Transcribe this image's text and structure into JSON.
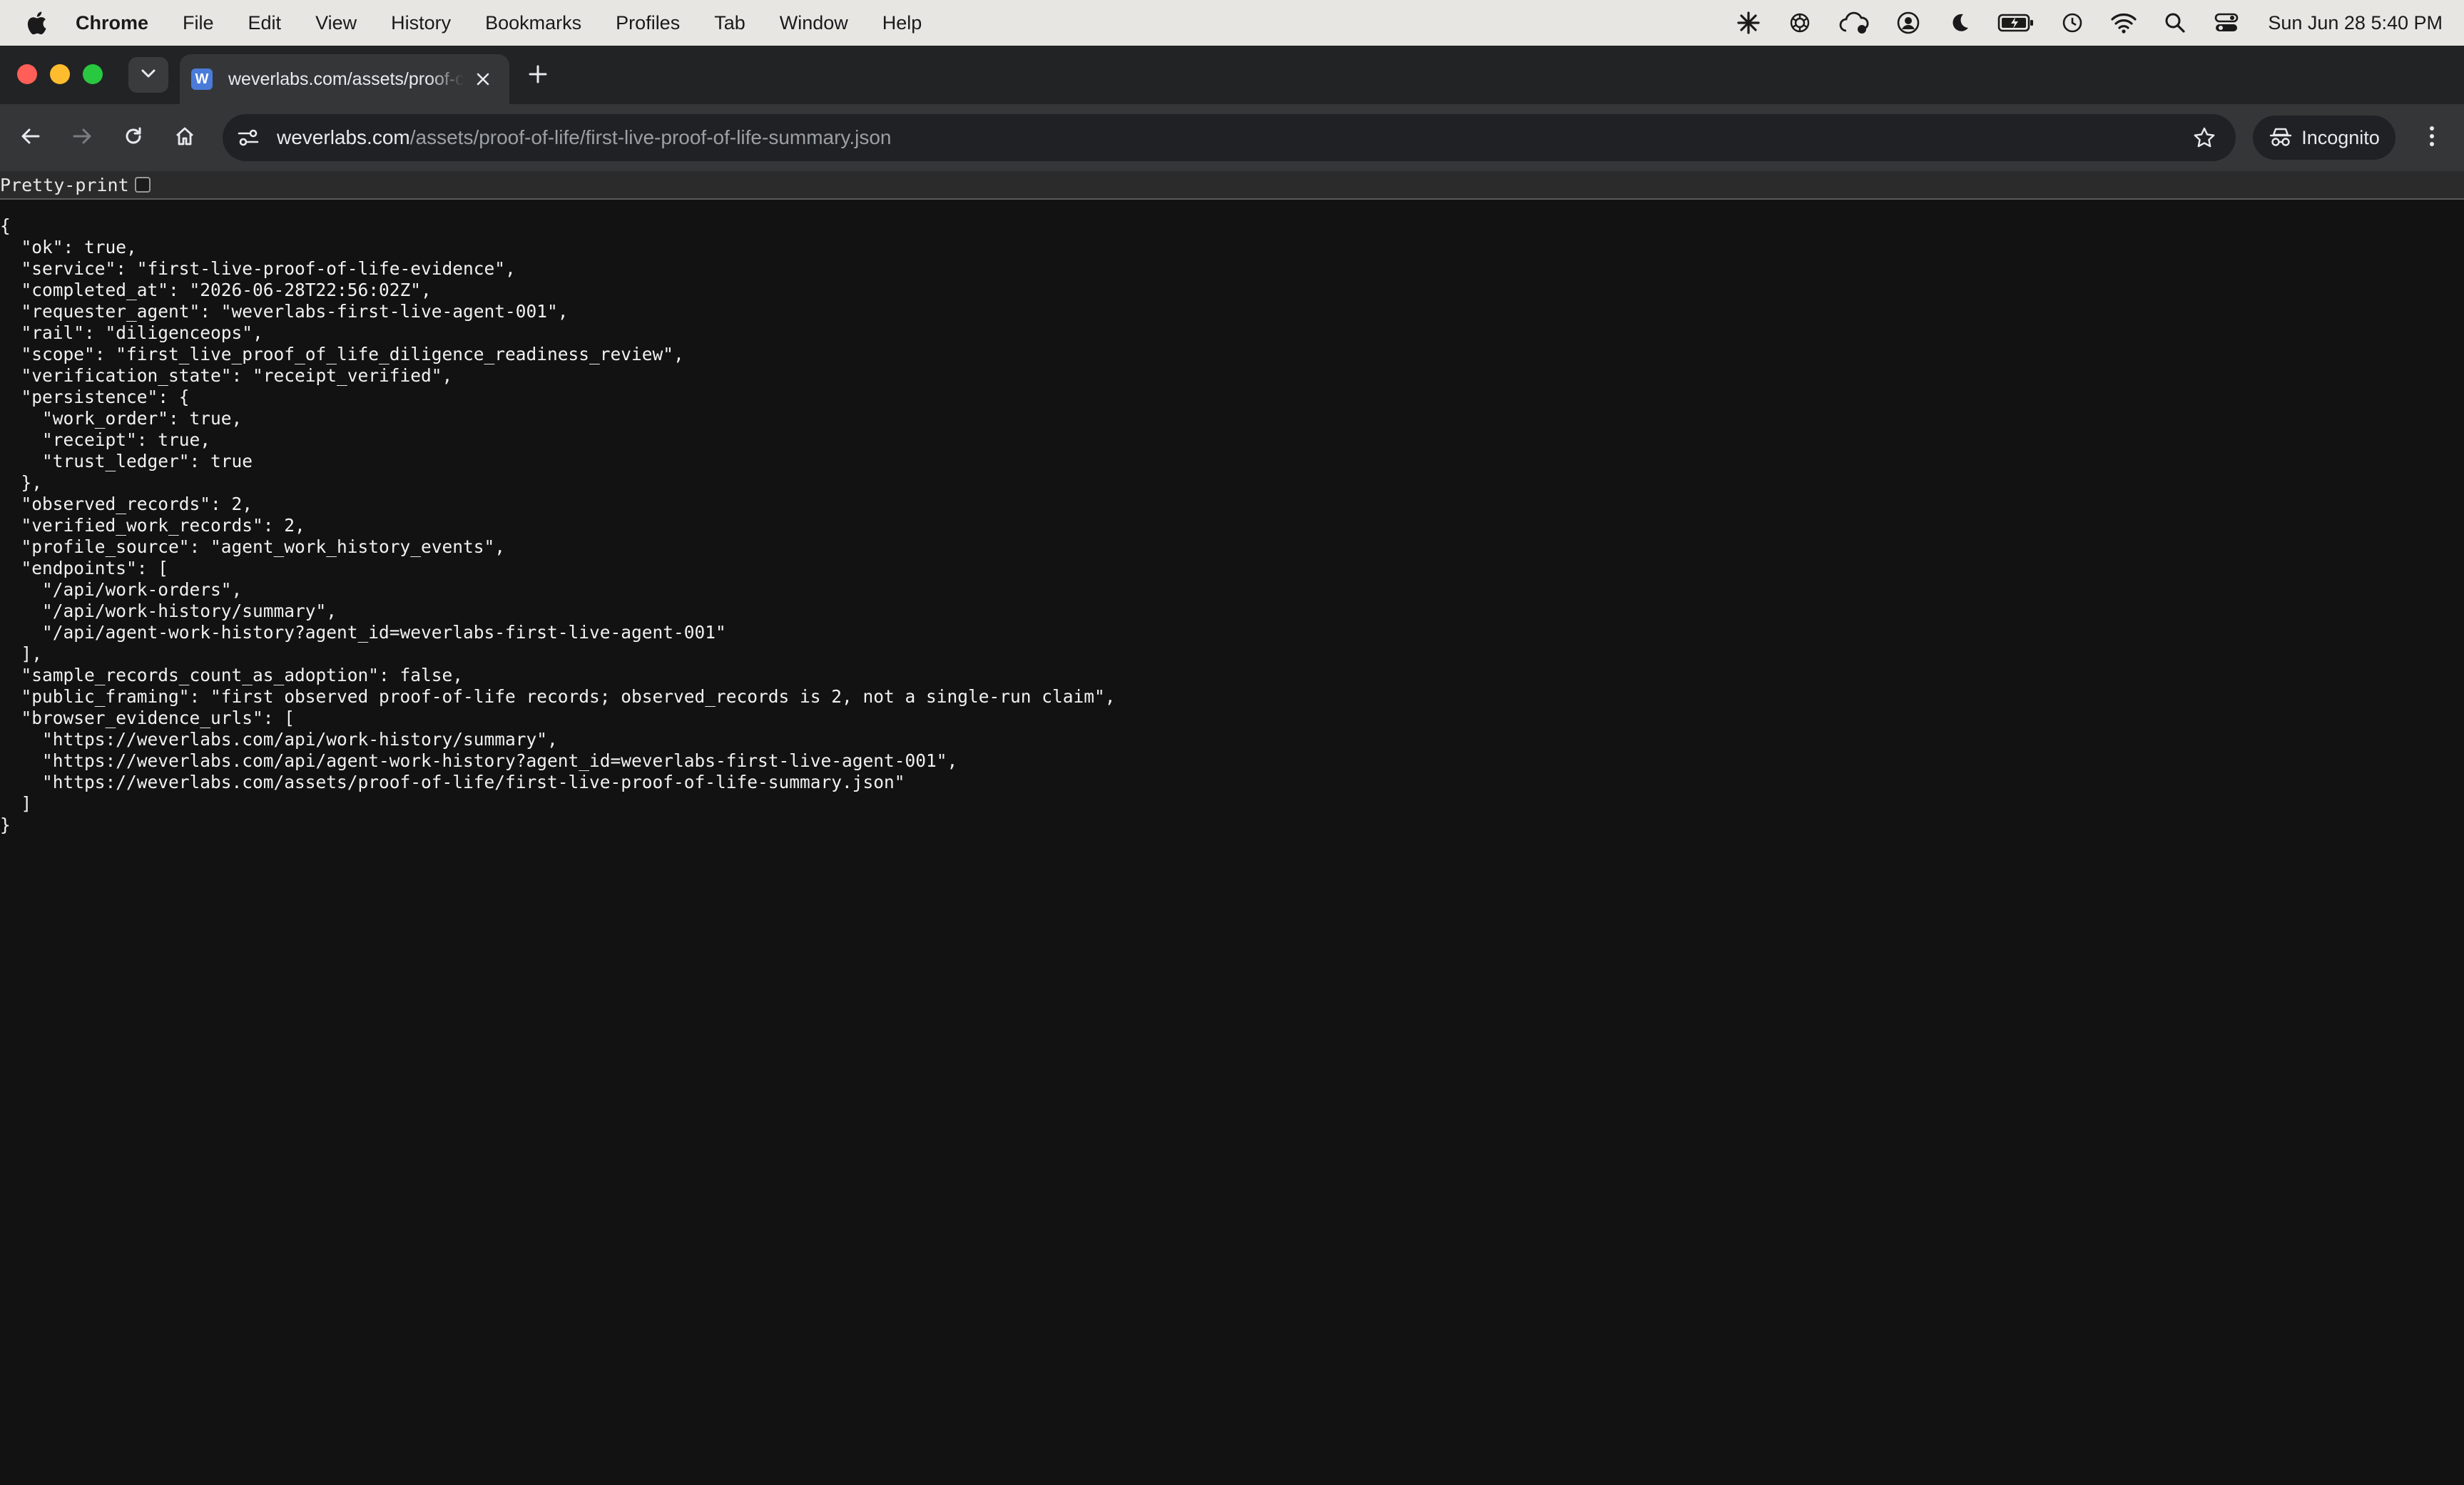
{
  "menubar": {
    "app_name": "Chrome",
    "items": [
      "File",
      "Edit",
      "View",
      "History",
      "Bookmarks",
      "Profiles",
      "Tab",
      "Window",
      "Help"
    ],
    "clock": "Sun Jun 28  5:40 PM",
    "status_icons": [
      "sparkle-icon",
      "openai-icon",
      "cloud-sync-icon",
      "user-circle-icon",
      "moon-icon",
      "battery-charging-icon",
      "clock-history-icon",
      "wifi-icon",
      "search-icon",
      "control-center-icon"
    ]
  },
  "tab": {
    "title": "weverlabs.com/assets/proof-of-life/first-live-proof-of-life-summary.json",
    "favicon_letter": "W"
  },
  "omnibox": {
    "host": "weverlabs.com",
    "path": "/assets/proof-of-life/first-live-proof-of-life-summary.json"
  },
  "incognito_label": "Incognito",
  "pretty_print_label": "Pretty-print",
  "json_lines": [
    "{",
    "  \"ok\": true,",
    "  \"service\": \"first-live-proof-of-life-evidence\",",
    "  \"completed_at\": \"2026-06-28T22:56:02Z\",",
    "  \"requester_agent\": \"weverlabs-first-live-agent-001\",",
    "  \"rail\": \"diligenceops\",",
    "  \"scope\": \"first_live_proof_of_life_diligence_readiness_review\",",
    "  \"verification_state\": \"receipt_verified\",",
    "  \"persistence\": {",
    "    \"work_order\": true,",
    "    \"receipt\": true,",
    "    \"trust_ledger\": true",
    "  },",
    "  \"observed_records\": 2,",
    "  \"verified_work_records\": 2,",
    "  \"profile_source\": \"agent_work_history_events\",",
    "  \"endpoints\": [",
    "    \"/api/work-orders\",",
    "    \"/api/work-history/summary\",",
    "    \"/api/agent-work-history?agent_id=weverlabs-first-live-agent-001\"",
    "  ],",
    "  \"sample_records_count_as_adoption\": false,",
    "  \"public_framing\": \"first observed proof-of-life records; observed_records is 2, not a single-run claim\",",
    "  \"browser_evidence_urls\": [",
    "    \"https://weverlabs.com/api/work-history/summary\",",
    "    \"https://weverlabs.com/api/agent-work-history?agent_id=weverlabs-first-live-agent-001\",",
    "    \"https://weverlabs.com/assets/proof-of-life/first-live-proof-of-life-summary.json\"",
    "  ]",
    "}"
  ]
}
